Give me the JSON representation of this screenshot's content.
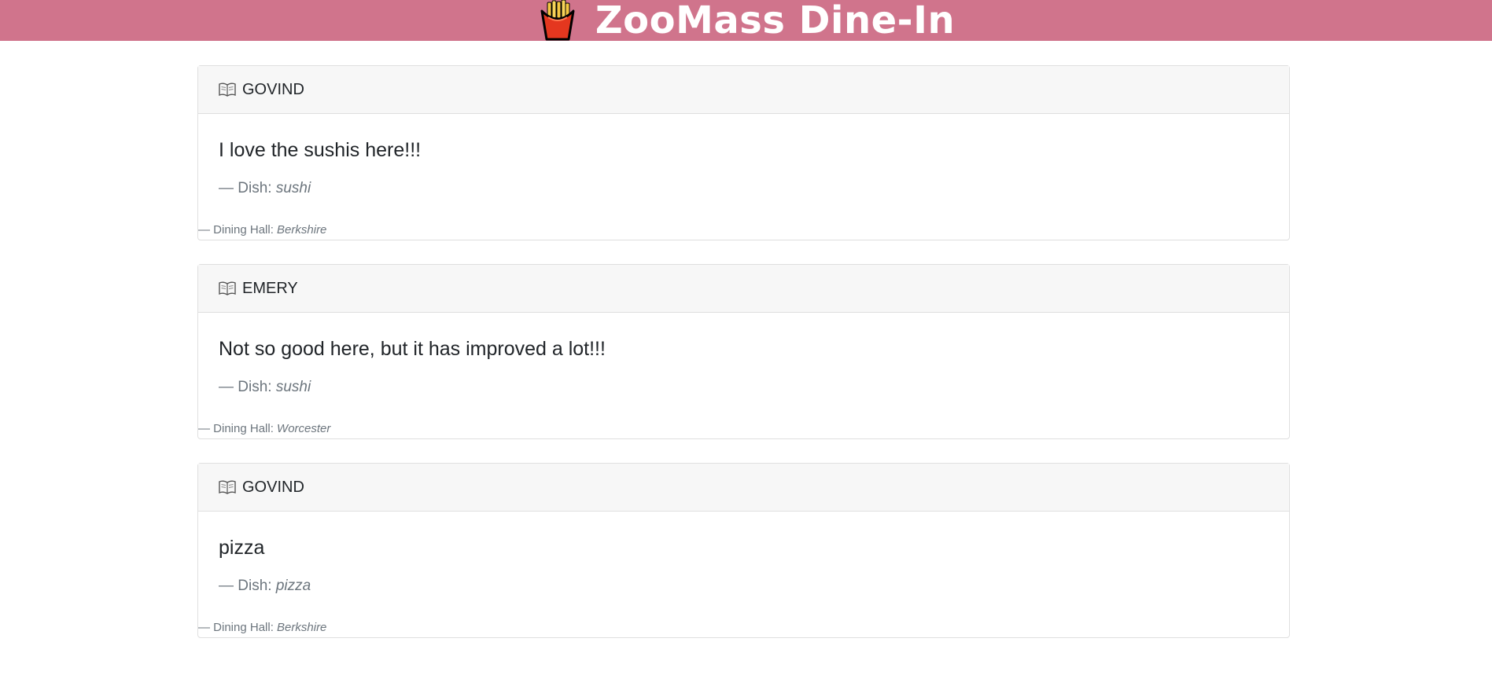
{
  "header": {
    "title": "ZooMass Dine-In",
    "logo_icon": "fries-icon",
    "background_color": "#d0748c"
  },
  "labels": {
    "dish_prefix": "— Dish: ",
    "hall_prefix": "— Dining Hall: "
  },
  "reviews": [
    {
      "author": "GOVIND",
      "text": "I love the sushis here!!!",
      "dish": "sushi",
      "hall": "Berkshire"
    },
    {
      "author": "EMERY",
      "text": "Not so good here, but it has improved a lot!!!",
      "dish": "sushi",
      "hall": "Worcester"
    },
    {
      "author": "GOVIND",
      "text": "pizza",
      "dish": "pizza",
      "hall": "Berkshire"
    }
  ]
}
